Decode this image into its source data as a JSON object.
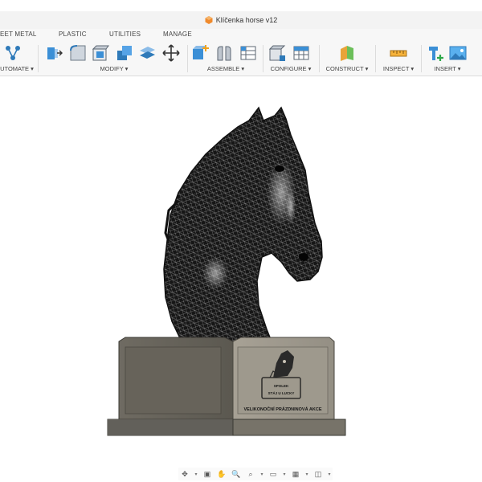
{
  "window": {
    "title": "Klíčenka horse v12"
  },
  "tabs": [
    "EET METAL",
    "PLASTIC",
    "UTILITIES",
    "MANAGE"
  ],
  "ribbon": {
    "automate": "UTOMATE ▾",
    "modify": "MODIFY ▾",
    "assemble": "ASSEMBLE ▾",
    "configure": "CONFIGURE ▾",
    "construct": "CONSTRUCT ▾",
    "inspect": "INSPECT ▾",
    "insert": "INSERT ▾"
  },
  "model": {
    "plaque_line1": "SPOLEK",
    "plaque_line2": "STÁJ U LUCKY",
    "plaque_caption": "VELIKONOČNÍ PRÁZDNINOVÁ AKCE"
  },
  "colors": {
    "accent": "#1f8fd6",
    "base_gray": "#8d887c",
    "mesh": "#1b1b1b"
  },
  "navbar": {
    "icons": [
      "orbit-icon",
      "look-at-icon",
      "pan-icon",
      "zoom-icon",
      "fit-icon",
      "display-settings-icon",
      "grid-icon",
      "viewports-icon"
    ]
  }
}
